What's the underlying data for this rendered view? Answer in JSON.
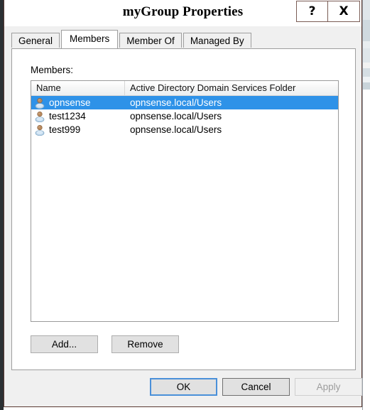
{
  "window": {
    "title": "myGroup Properties",
    "help_button_label": "?",
    "close_button_label": "X",
    "help_icon": "question-mark-icon",
    "close_icon": "close-x-icon"
  },
  "tabs": [
    {
      "label": "General",
      "active": false
    },
    {
      "label": "Members",
      "active": true
    },
    {
      "label": "Member Of",
      "active": false
    },
    {
      "label": "Managed By",
      "active": false
    }
  ],
  "members_panel": {
    "label": "Members:",
    "columns": [
      "Name",
      "Active Directory Domain Services Folder"
    ],
    "rows": [
      {
        "name": "opnsense",
        "folder": "opnsense.local/Users",
        "icon": "user-icon",
        "selected": true
      },
      {
        "name": "test1234",
        "folder": "opnsense.local/Users",
        "icon": "user-icon",
        "selected": false
      },
      {
        "name": "test999",
        "folder": "opnsense.local/Users",
        "icon": "user-icon",
        "selected": false
      }
    ],
    "add_label": "Add...",
    "remove_label": "Remove"
  },
  "footer": {
    "ok_label": "OK",
    "cancel_label": "Cancel",
    "apply_label": "Apply",
    "apply_enabled": false
  },
  "colors": {
    "selection_blue": "#2e92e8",
    "focus_border": "#4a90d9",
    "dialog_face": "#f0f0f0",
    "panel_white": "#ffffff",
    "disabled_text": "#9d9d9d",
    "window_border": "#5a3a33"
  }
}
